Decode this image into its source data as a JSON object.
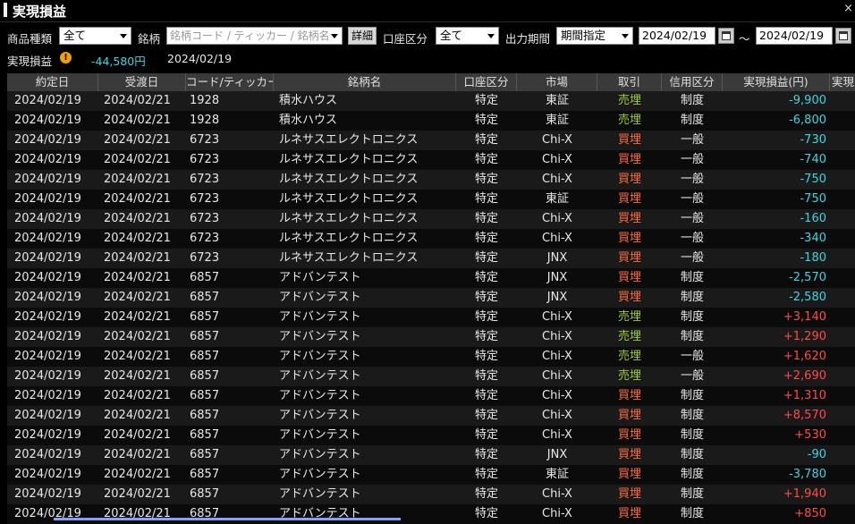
{
  "window": {
    "title": "実現損益",
    "close_glyph": "×"
  },
  "filters": {
    "product_type_label": "商品種類",
    "product_type_value": "全て",
    "symbol_label": "銘柄",
    "symbol_placeholder": "銘柄コード / ティッカー / 銘柄名",
    "detail_button": "詳細",
    "account_label": "口座区分",
    "account_value": "全て",
    "period_label": "出力期間",
    "period_value": "期間指定",
    "date_from": "2024/02/19",
    "tilde": "～",
    "date_to": "2024/02/19"
  },
  "summary": {
    "label": "実現損益",
    "value": "-44,580円",
    "date": "2024/02/19"
  },
  "columns": [
    "約定日",
    "受渡日",
    "コード/ティッカー",
    "銘柄名",
    "口座区分",
    "市場",
    "取引",
    "信用区分",
    "実現損益(円)",
    "実現"
  ],
  "rows": [
    [
      "2024/02/19",
      "2024/02/21",
      "1928",
      "積水ハウス",
      "特定",
      "東証",
      "売埋",
      "制度",
      "-9,900"
    ],
    [
      "2024/02/19",
      "2024/02/21",
      "1928",
      "積水ハウス",
      "特定",
      "東証",
      "売埋",
      "制度",
      "-6,800"
    ],
    [
      "2024/02/19",
      "2024/02/21",
      "6723",
      "ルネサスエレクトロニクス",
      "特定",
      "Chi-X",
      "買埋",
      "一般",
      "-730"
    ],
    [
      "2024/02/19",
      "2024/02/21",
      "6723",
      "ルネサスエレクトロニクス",
      "特定",
      "Chi-X",
      "買埋",
      "一般",
      "-740"
    ],
    [
      "2024/02/19",
      "2024/02/21",
      "6723",
      "ルネサスエレクトロニクス",
      "特定",
      "Chi-X",
      "買埋",
      "一般",
      "-750"
    ],
    [
      "2024/02/19",
      "2024/02/21",
      "6723",
      "ルネサスエレクトロニクス",
      "特定",
      "東証",
      "買埋",
      "一般",
      "-750"
    ],
    [
      "2024/02/19",
      "2024/02/21",
      "6723",
      "ルネサスエレクトロニクス",
      "特定",
      "Chi-X",
      "買埋",
      "一般",
      "-160"
    ],
    [
      "2024/02/19",
      "2024/02/21",
      "6723",
      "ルネサスエレクトロニクス",
      "特定",
      "Chi-X",
      "買埋",
      "一般",
      "-340"
    ],
    [
      "2024/02/19",
      "2024/02/21",
      "6723",
      "ルネサスエレクトロニクス",
      "特定",
      "JNX",
      "買埋",
      "一般",
      "-180"
    ],
    [
      "2024/02/19",
      "2024/02/21",
      "6857",
      "アドバンテスト",
      "特定",
      "JNX",
      "買埋",
      "制度",
      "-2,570"
    ],
    [
      "2024/02/19",
      "2024/02/21",
      "6857",
      "アドバンテスト",
      "特定",
      "JNX",
      "買埋",
      "制度",
      "-2,580"
    ],
    [
      "2024/02/19",
      "2024/02/21",
      "6857",
      "アドバンテスト",
      "特定",
      "Chi-X",
      "売埋",
      "制度",
      "+3,140"
    ],
    [
      "2024/02/19",
      "2024/02/21",
      "6857",
      "アドバンテスト",
      "特定",
      "Chi-X",
      "売埋",
      "制度",
      "+1,290"
    ],
    [
      "2024/02/19",
      "2024/02/21",
      "6857",
      "アドバンテスト",
      "特定",
      "Chi-X",
      "売埋",
      "一般",
      "+1,620"
    ],
    [
      "2024/02/19",
      "2024/02/21",
      "6857",
      "アドバンテスト",
      "特定",
      "Chi-X",
      "売埋",
      "一般",
      "+2,690"
    ],
    [
      "2024/02/19",
      "2024/02/21",
      "6857",
      "アドバンテスト",
      "特定",
      "Chi-X",
      "買埋",
      "制度",
      "+1,310"
    ],
    [
      "2024/02/19",
      "2024/02/21",
      "6857",
      "アドバンテスト",
      "特定",
      "Chi-X",
      "買埋",
      "制度",
      "+8,570"
    ],
    [
      "2024/02/19",
      "2024/02/21",
      "6857",
      "アドバンテスト",
      "特定",
      "Chi-X",
      "買埋",
      "制度",
      "+530"
    ],
    [
      "2024/02/19",
      "2024/02/21",
      "6857",
      "アドバンテスト",
      "特定",
      "JNX",
      "買埋",
      "制度",
      "-90"
    ],
    [
      "2024/02/19",
      "2024/02/21",
      "6857",
      "アドバンテスト",
      "特定",
      "東証",
      "買埋",
      "制度",
      "-3,780"
    ],
    [
      "2024/02/19",
      "2024/02/21",
      "6857",
      "アドバンテスト",
      "特定",
      "Chi-X",
      "買埋",
      "制度",
      "+1,940"
    ],
    [
      "2024/02/19",
      "2024/02/21",
      "6857",
      "アドバンテスト",
      "特定",
      "Chi-X",
      "買埋",
      "制度",
      "+850"
    ]
  ],
  "colors": {
    "sell": "#9ccc3a",
    "buy": "#ff6a3a",
    "negative": "#3dd6e0",
    "positive": "#ff4a4a"
  }
}
